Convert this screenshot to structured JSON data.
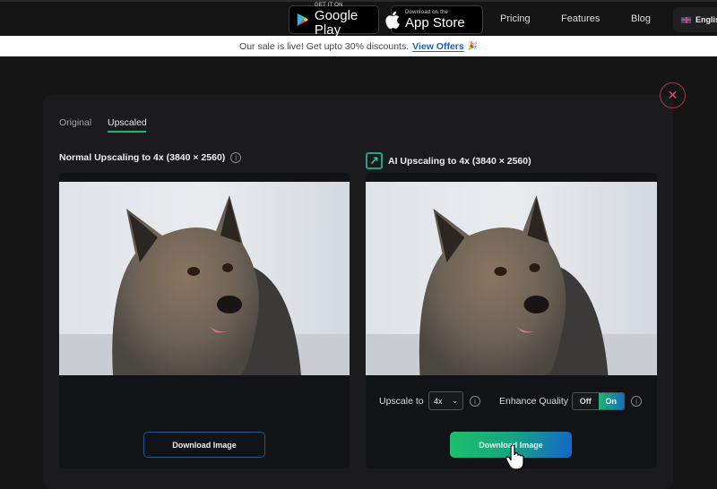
{
  "nav": {
    "google_play": {
      "small": "GET IT ON",
      "big": "Google Play"
    },
    "app_store": {
      "small": "Download on the",
      "big": "App Store"
    },
    "links": [
      "Pricing",
      "Features",
      "Blog"
    ],
    "language": "English"
  },
  "banner": {
    "text": "Our sale is live! Get upto 30% discounts.",
    "link": "View Offers",
    "emoji": "🎉"
  },
  "tabs": [
    {
      "label": "Original",
      "active": false
    },
    {
      "label": "Upscaled",
      "active": true
    }
  ],
  "left_panel": {
    "heading": "Normal Upscaling to 4x (3840 × 2560)",
    "download_label": "Download Image"
  },
  "right_panel": {
    "heading": "AI Upscaling to 4x (3840 × 2560)",
    "upscale_label": "Upscale to",
    "upscale_value": "4x",
    "enhance_label": "Enhance Quality",
    "toggle_off": "Off",
    "toggle_on": "On",
    "enhance_state": "On",
    "download_label": "Download Image"
  },
  "colors": {
    "accent_green": "#1fb878",
    "accent_blue": "#1466c8",
    "close_red": "#e0546b"
  }
}
